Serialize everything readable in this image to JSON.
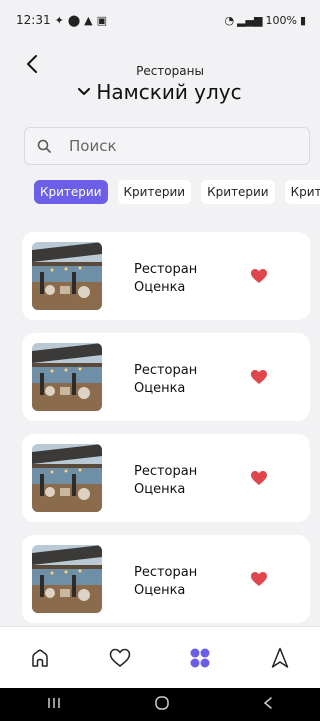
{
  "status": {
    "time": "12:31",
    "battery": "100%"
  },
  "header": {
    "subtitle": "Рестораны",
    "title": "Намский улус"
  },
  "search": {
    "placeholder": "Поиск"
  },
  "chips": [
    {
      "label": "Критерии",
      "active": true
    },
    {
      "label": "Критерии",
      "active": false
    },
    {
      "label": "Критерии",
      "active": false
    },
    {
      "label": "Крите",
      "active": false
    }
  ],
  "restaurants": [
    {
      "name": "Ресторан",
      "rating": "Оценка",
      "favorite": true
    },
    {
      "name": "Ресторан",
      "rating": "Оценка",
      "favorite": true
    },
    {
      "name": "Ресторан",
      "rating": "Оценка",
      "favorite": true
    },
    {
      "name": "Ресторан",
      "rating": "Оценка",
      "favorite": true
    }
  ],
  "nav": {
    "items": [
      "home-icon",
      "heart-outline-icon",
      "grid-dots-icon",
      "navigation-arrow-icon"
    ],
    "active": "grid-dots-icon"
  },
  "colors": {
    "accent": "#6d5ee8",
    "heart": "#e0474c",
    "background": "#f2f2f5"
  }
}
